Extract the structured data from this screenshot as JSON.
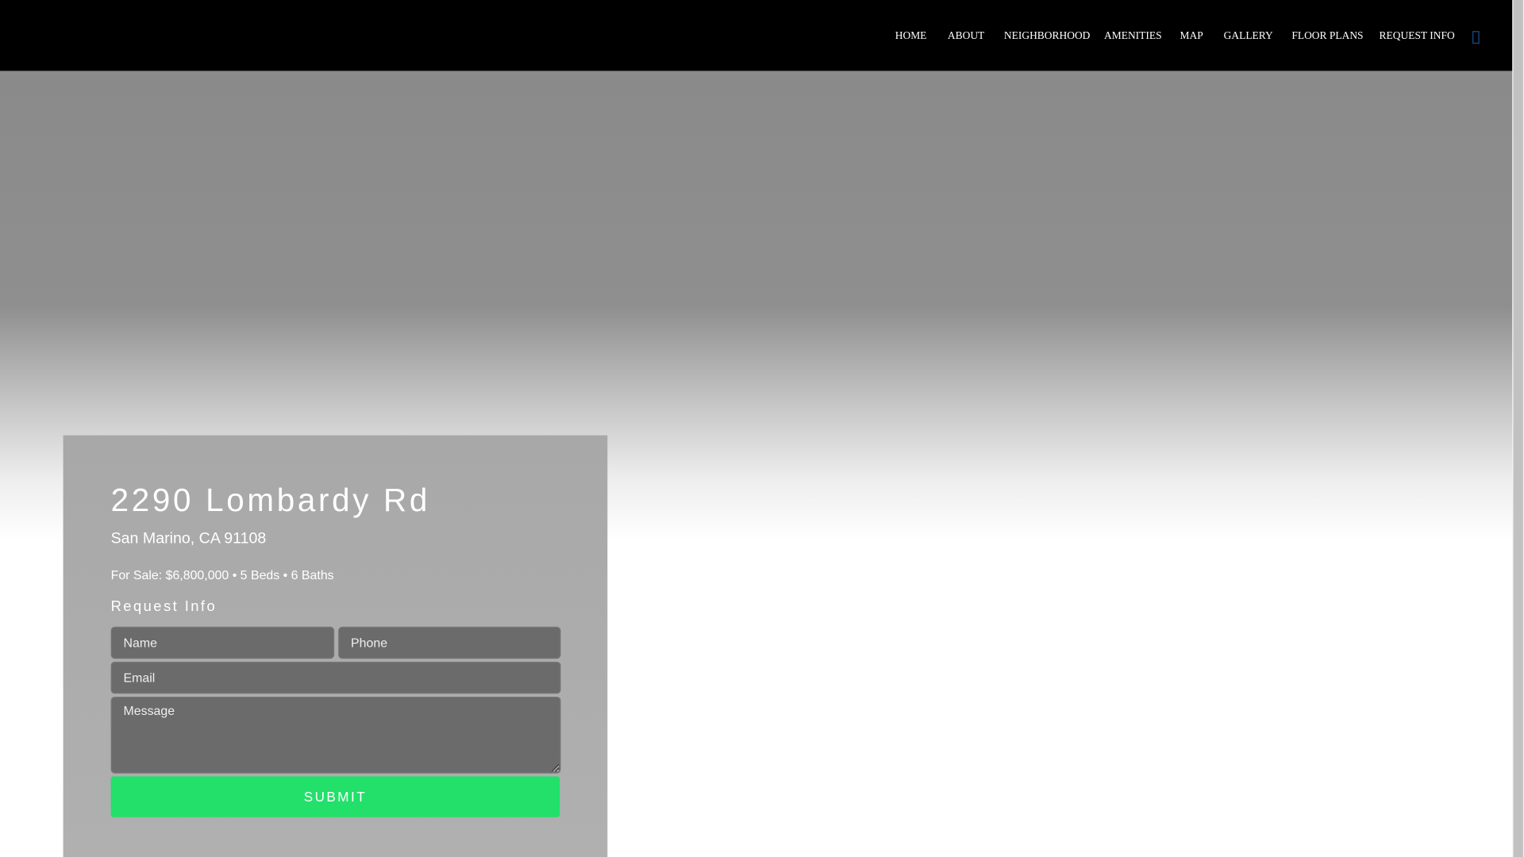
{
  "nav": {
    "items": [
      "HOME",
      "ABOUT",
      "NEIGHBORHOOD",
      "AMENITIES",
      "MAP",
      "GALLERY",
      "FLOOR PLANS",
      "REQUEST INFO"
    ],
    "menu_icon": "missing-glyph-icon"
  },
  "listing": {
    "address": "2290 Lombardy Rd",
    "city": "San Marino, CA 91108",
    "meta": "For Sale: $6,800,000 • 5 Beds • 6 Baths"
  },
  "form": {
    "title": "Request Info",
    "name_placeholder": "Name",
    "phone_placeholder": "Phone",
    "email_placeholder": "Email",
    "message_placeholder": "Message",
    "submit_label": "SUBMIT"
  },
  "colors": {
    "submit": "#22e06a",
    "nav_bg": "#000000"
  }
}
